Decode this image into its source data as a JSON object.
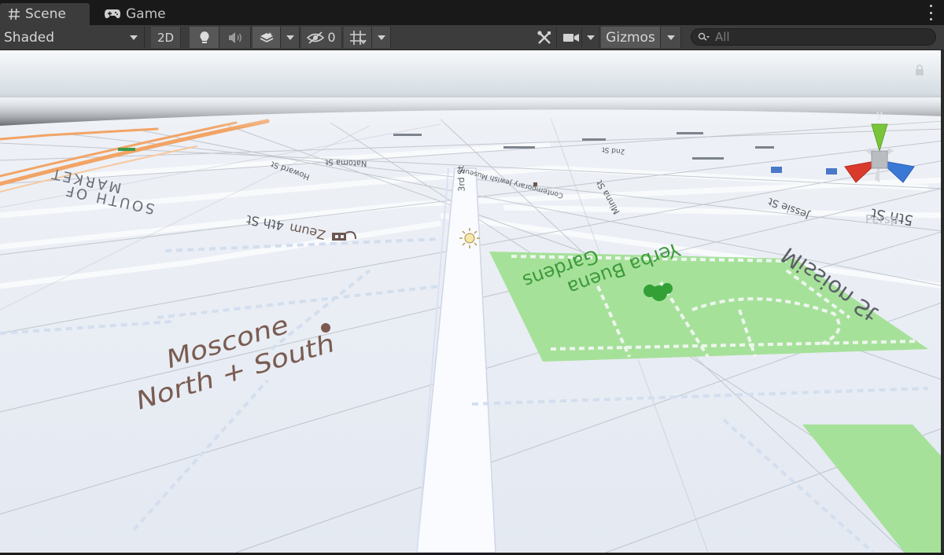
{
  "tabs": [
    {
      "label": "Scene",
      "icon": "hash-icon",
      "active": true
    },
    {
      "label": "Game",
      "icon": "gamepad-icon",
      "active": false
    }
  ],
  "toolbar": {
    "draw_mode": "Shaded",
    "mode_2d": "2D",
    "hidden_count": "0",
    "gizmos": "Gizmos"
  },
  "search": {
    "placeholder": "All"
  },
  "gizmo": {
    "axis_y": "y",
    "projection": "Persp"
  },
  "map": {
    "labels": {
      "moscone_1": "Moscone",
      "moscone_2": "North + South",
      "yerba_1": "Yerba Buena",
      "yerba_2": "Gardens",
      "mission": "Mission St",
      "fourth": "4th St",
      "zeum": "Zeum",
      "som_1": "SOUTH OF",
      "som_2": "MARKET",
      "third": "3rd St",
      "minna": "Minna St",
      "jessie": "Jessie St",
      "contemporary": "Contemporary Jewish Museum",
      "fifth": "5th St",
      "howard": "Howard St",
      "natoma": "Natoma St",
      "second": "2nd St"
    }
  },
  "colors": {
    "sky_top": "#f3f6f9",
    "sky_horizon": "#5f6468",
    "ground": "#e9edf4",
    "park": "#a6e19a",
    "park_text": "#3d9a3a",
    "street_text": "#5a5f66",
    "poi_text": "#7a5c52",
    "freeway": "#f0a366",
    "axis_x": "#d93a2b",
    "axis_y": "#7ac43a",
    "axis_z": "#3a78d6"
  }
}
